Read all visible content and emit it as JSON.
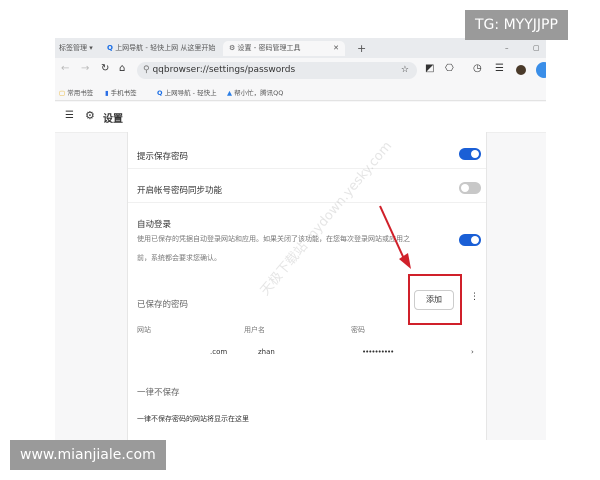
{
  "tabs": [
    {
      "label": "标签管理 ▾"
    },
    {
      "label": "上网导航 - 轻快上网 从这里开始"
    },
    {
      "label": "设置 - 密码管理工具",
      "active": true
    }
  ],
  "toolbar": {
    "url": "qqbrowser://settings/passwords"
  },
  "bookmarks": [
    {
      "label": "常用书签"
    },
    {
      "label": "手机书签"
    },
    {
      "label": "上网导航 - 轻快上"
    },
    {
      "label": "帮小忙，腾讯QQ"
    }
  ],
  "header": {
    "title": "设置"
  },
  "settings": {
    "offer_save": {
      "label": "提示保存密码",
      "enabled": true
    },
    "sync": {
      "label": "开启帐号密码同步功能",
      "enabled": false
    },
    "auto_login": {
      "label": "自动登录",
      "desc1": "使用已保存的凭据自动登录网站和应用。如果关闭了该功能，在您每次登录网站或应用之",
      "desc2": "前，系统都会要求您确认。",
      "enabled": true
    }
  },
  "saved": {
    "title": "已保存的密码",
    "add_label": "添加",
    "columns": [
      "网站",
      "用户名",
      "密码"
    ],
    "rows": [
      {
        "site": ".com",
        "user": "zhan",
        "password": "••••••••••"
      }
    ]
  },
  "never": {
    "title": "一律不保存",
    "empty": "一律不保存密码的网站将显示在这里"
  },
  "watermarks": {
    "top": "TG: MYYJJPP",
    "bottom": "www.mianjiale.com",
    "diag": "天极下载站 mydown.yesky.com"
  },
  "colors": {
    "accent": "#1a5fd6",
    "annotation": "#d0202a"
  }
}
